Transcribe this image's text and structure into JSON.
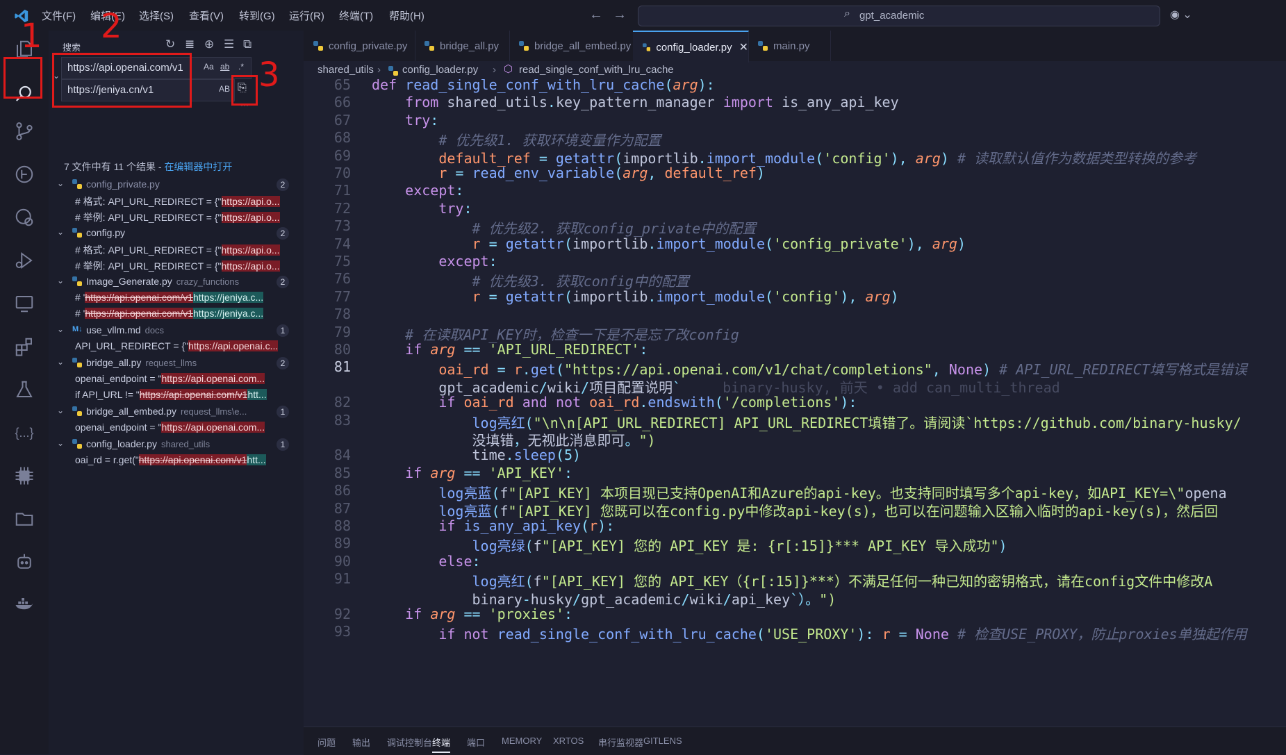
{
  "menu": [
    "文件(F)",
    "编辑(E)",
    "选择(S)",
    "查看(V)",
    "转到(G)",
    "运行(R)",
    "终端(T)",
    "帮助(H)"
  ],
  "command_center": "gpt_academic",
  "sidebar": {
    "title": "搜索",
    "search_value": "https://api.openai.com/v1",
    "replace_value": "https://jeniya.cn/v1",
    "options": {
      "case": "Aa",
      "word": "ab",
      "regex": ".*",
      "preserve_case": "AB"
    },
    "summary_prefix": "7 文件中有 11 个结果 - ",
    "summary_link": "在编辑器中打开",
    "results": [
      {
        "file": "config_private.py",
        "path": "",
        "count": "2",
        "matches": [
          {
            "before": "# 格式: API_URL_REDIRECT = {\"",
            "old": "https://api.o...",
            "new": ""
          },
          {
            "before": "# 举例: API_URL_REDIRECT = {\"",
            "old": "https://api.o...",
            "new": ""
          }
        ]
      },
      {
        "file": "config.py",
        "path": "",
        "count": "2",
        "matches": [
          {
            "before": "# 格式: API_URL_REDIRECT = {\"",
            "old": "https://api.o...",
            "new": ""
          },
          {
            "before": "# 举例: API_URL_REDIRECT = {\"",
            "old": "https://api.o...",
            "new": ""
          }
        ]
      },
      {
        "file": "Image_Generate.py",
        "path": "crazy_functions",
        "count": "2",
        "matches": [
          {
            "before": "# '",
            "old": "https://api.openai.com/v1",
            "new": "https://jeniya.c..."
          },
          {
            "before": "# '",
            "old": "https://api.openai.com/v1",
            "new": "https://jeniya.c..."
          }
        ]
      },
      {
        "file": "use_vllm.md",
        "path": "docs",
        "count": "1",
        "matches": [
          {
            "before": "API_URL_REDIRECT = {\"",
            "old": "https://api.openai.c...",
            "new": ""
          }
        ]
      },
      {
        "file": "bridge_all.py",
        "path": "request_llms",
        "count": "2",
        "matches": [
          {
            "before": "openai_endpoint = \"",
            "old": "https://api.openai.com...",
            "new": ""
          },
          {
            "before": "if API_URL != \"",
            "old": "https://api.openai.com/v1",
            "new": "htt..."
          }
        ]
      },
      {
        "file": "bridge_all_embed.py",
        "path": "request_llms\\e...",
        "count": "1",
        "matches": [
          {
            "before": "openai_endpoint = \"",
            "old": "https://api.openai.com...",
            "new": ""
          }
        ]
      },
      {
        "file": "config_loader.py",
        "path": "shared_utils",
        "count": "1",
        "matches": [
          {
            "before": "oai_rd = r.get(\"",
            "old": "https://api.openai.com/v1",
            "new": "htt..."
          }
        ]
      }
    ]
  },
  "annotations": {
    "one": "1",
    "two": "2",
    "three": "3"
  },
  "tabs": [
    {
      "label": "config_private.py",
      "active": false
    },
    {
      "label": "bridge_all.py",
      "active": false
    },
    {
      "label": "bridge_all_embed.py",
      "active": false
    },
    {
      "label": "config_loader.py",
      "active": true
    },
    {
      "label": "main.py",
      "active": false
    }
  ],
  "breadcrumb": [
    "shared_utils",
    "config_loader.py",
    "read_single_conf_with_lru_cache"
  ],
  "editor": {
    "current_line": "81",
    "lines": [
      {
        "n": "65",
        "code": "def read_single_conf_with_lru_cache(arg):"
      },
      {
        "n": "66",
        "code": "    from shared_utils.key_pattern_manager import is_any_api_key"
      },
      {
        "n": "67",
        "code": "    try:"
      },
      {
        "n": "68",
        "code": "        # 优先级1. 获取环境变量作为配置"
      },
      {
        "n": "69",
        "code": "        default_ref = getattr(importlib.import_module('config'), arg) # 读取默认值作为数据类型转换的参考"
      },
      {
        "n": "70",
        "code": "        r = read_env_variable(arg, default_ref)"
      },
      {
        "n": "71",
        "code": "    except:"
      },
      {
        "n": "72",
        "code": "        try:"
      },
      {
        "n": "73",
        "code": "            # 优先级2. 获取config_private中的配置"
      },
      {
        "n": "74",
        "code": "            r = getattr(importlib.import_module('config_private'), arg)"
      },
      {
        "n": "75",
        "code": "        except:"
      },
      {
        "n": "76",
        "code": "            # 优先级3. 获取config中的配置"
      },
      {
        "n": "77",
        "code": "            r = getattr(importlib.import_module('config'), arg)"
      },
      {
        "n": "78",
        "code": ""
      },
      {
        "n": "79",
        "code": "    # 在读取API_KEY时，检查一下是不是忘了改config"
      },
      {
        "n": "80",
        "code": "    if arg == 'API_URL_REDIRECT':"
      },
      {
        "n": "81",
        "code": "        oai_rd = r.get(\"https://api.openai.com/v1/chat/completions\", None) # API_URL_REDIRECT填写格式是错误"
      },
      {
        "n": "",
        "code": "        gpt_academic/wiki/项目配置说明`"
      },
      {
        "n": "82",
        "code": "        if oai_rd and not oai_rd.endswith('/completions'):"
      },
      {
        "n": "83",
        "code": "            log亮红(\"\\n\\n[API_URL_REDIRECT] API_URL_REDIRECT填错了。请阅读`https://github.com/binary-husky/"
      },
      {
        "n": "",
        "code": "            没填错，无视此消息即可。\")"
      },
      {
        "n": "84",
        "code": "            time.sleep(5)"
      },
      {
        "n": "85",
        "code": "    if arg == 'API_KEY':"
      },
      {
        "n": "86",
        "code": "        log亮蓝(f\"[API_KEY] 本项目现已支持OpenAI和Azure的api-key。也支持同时填写多个api-key，如API_KEY=\\\"opena"
      },
      {
        "n": "87",
        "code": "        log亮蓝(f\"[API_KEY] 您既可以在config.py中修改api-key(s)，也可以在问题输入区输入临时的api-key(s)，然后回"
      },
      {
        "n": "88",
        "code": "        if is_any_api_key(r):"
      },
      {
        "n": "89",
        "code": "            log亮绿(f\"[API_KEY] 您的 API_KEY 是: {r[:15]}*** API_KEY 导入成功\")"
      },
      {
        "n": "90",
        "code": "        else:"
      },
      {
        "n": "91",
        "code": "            log亮红(f\"[API_KEY] 您的 API_KEY（{r[:15]}***）不满足任何一种已知的密钥格式，请在config文件中修改A"
      },
      {
        "n": "",
        "code": "            binary-husky/gpt_academic/wiki/api_key`）。\")"
      },
      {
        "n": "92",
        "code": "    if arg == 'proxies':"
      },
      {
        "n": "93",
        "code": "        if not read_single_conf_with_lru_cache('USE_PROXY'): r = None # 检查USE_PROXY，防止proxies单独起作用"
      }
    ],
    "blame": "binary-husky, 前天 • add can_multi_thread"
  },
  "panel_tabs": [
    "问题",
    "输出",
    "调试控制台",
    "终端",
    "端口",
    "MEMORY",
    "XRTOS",
    "串行监视器",
    "GITLENS"
  ],
  "panel_active": "终端"
}
